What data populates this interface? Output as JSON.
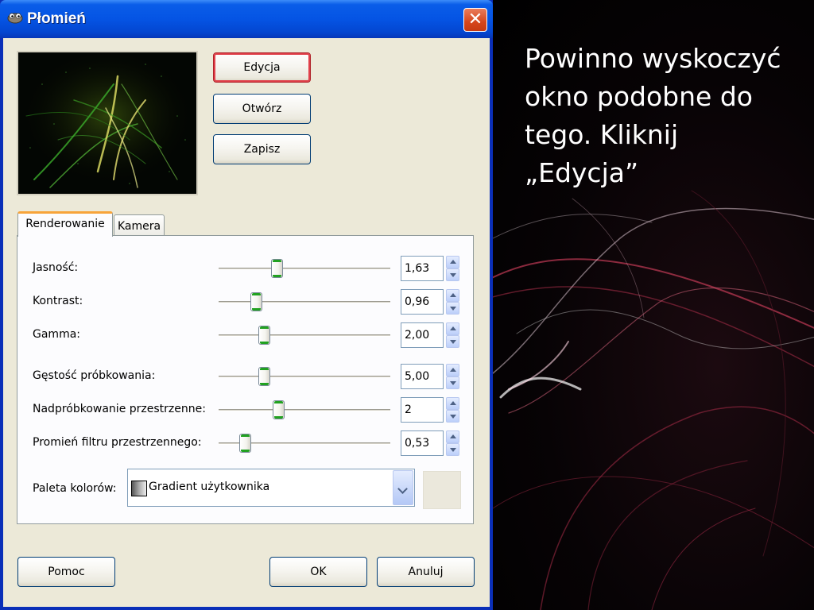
{
  "window": {
    "title": "Płomień",
    "close_symbol": "✕"
  },
  "preview_buttons": {
    "edit_label": "Edycja",
    "open_label": "Otwórz",
    "save_label": "Zapisz"
  },
  "tabs": {
    "render_label": "Renderowanie",
    "camera_label": "Kamera"
  },
  "params": {
    "brightness": {
      "label": "Jasność:",
      "value": "1,63"
    },
    "contrast": {
      "label": "Kontrast:",
      "value": "0,96"
    },
    "gamma": {
      "label": "Gamma:",
      "value": "2,00"
    },
    "sample_density": {
      "label": "Gęstość próbkowania:",
      "value": "5,00"
    },
    "spatial_oversample": {
      "label": "Nadpróbkowanie przestrzenne:",
      "value": "2"
    },
    "spatial_filter_radius": {
      "label": "Promień filtru przestrzennego:",
      "value": "0,53"
    }
  },
  "palette": {
    "label": "Paleta kolorów:",
    "value": "Gradient użytkownika"
  },
  "footer": {
    "help_label": "Pomoc",
    "ok_label": "OK",
    "cancel_label": "Anuluj"
  },
  "slide": {
    "line1": "Powinno wyskoczyć",
    "line2": "okno podobne do",
    "line3": "tego. Kliknij",
    "line4": "„Edycja”"
  },
  "colors": {
    "titlebar": "#0554e4",
    "dialog_bg": "#ece9d8",
    "focus_ring": "#e0404a",
    "slider_thumb_accent": "#21a121",
    "active_tab_accent": "#f7a43a"
  }
}
